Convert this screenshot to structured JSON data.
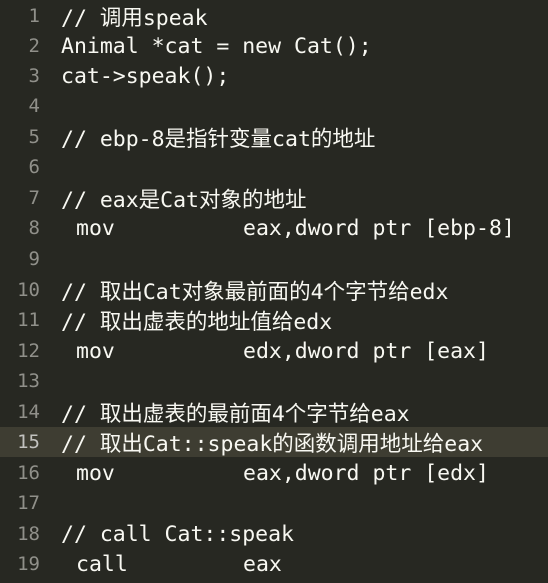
{
  "editor": {
    "active_line": 15,
    "colors": {
      "background": "#272822",
      "active_line_background": "#3e3d32",
      "text": "#f8f8f2",
      "gutter_text": "#90908a"
    },
    "lines": [
      {
        "num": "1",
        "text": "// 调用speak"
      },
      {
        "num": "2",
        "text": "Animal *cat = new Cat();"
      },
      {
        "num": "3",
        "text": "cat->speak();"
      },
      {
        "num": "4",
        "text": ""
      },
      {
        "num": "5",
        "text": "// ebp-8是指针变量cat的地址"
      },
      {
        "num": "6",
        "text": ""
      },
      {
        "num": "7",
        "text": "// eax是Cat对象的地址"
      },
      {
        "num": "8",
        "mnemonic": "mov",
        "operands": "eax,dword ptr [ebp-8]"
      },
      {
        "num": "9",
        "text": ""
      },
      {
        "num": "10",
        "text": "// 取出Cat对象最前面的4个字节给edx"
      },
      {
        "num": "11",
        "text": "// 取出虚表的地址值给edx"
      },
      {
        "num": "12",
        "mnemonic": "mov",
        "operands": "edx,dword ptr [eax]"
      },
      {
        "num": "13",
        "text": ""
      },
      {
        "num": "14",
        "text": "// 取出虚表的最前面4个字节给eax"
      },
      {
        "num": "15",
        "text": "// 取出Cat::speak的函数调用地址给eax"
      },
      {
        "num": "16",
        "mnemonic": "mov",
        "operands": "eax,dword ptr [edx]"
      },
      {
        "num": "17",
        "text": ""
      },
      {
        "num": "18",
        "text": "// call Cat::speak"
      },
      {
        "num": "19",
        "mnemonic": "call",
        "operands": "eax"
      }
    ]
  }
}
